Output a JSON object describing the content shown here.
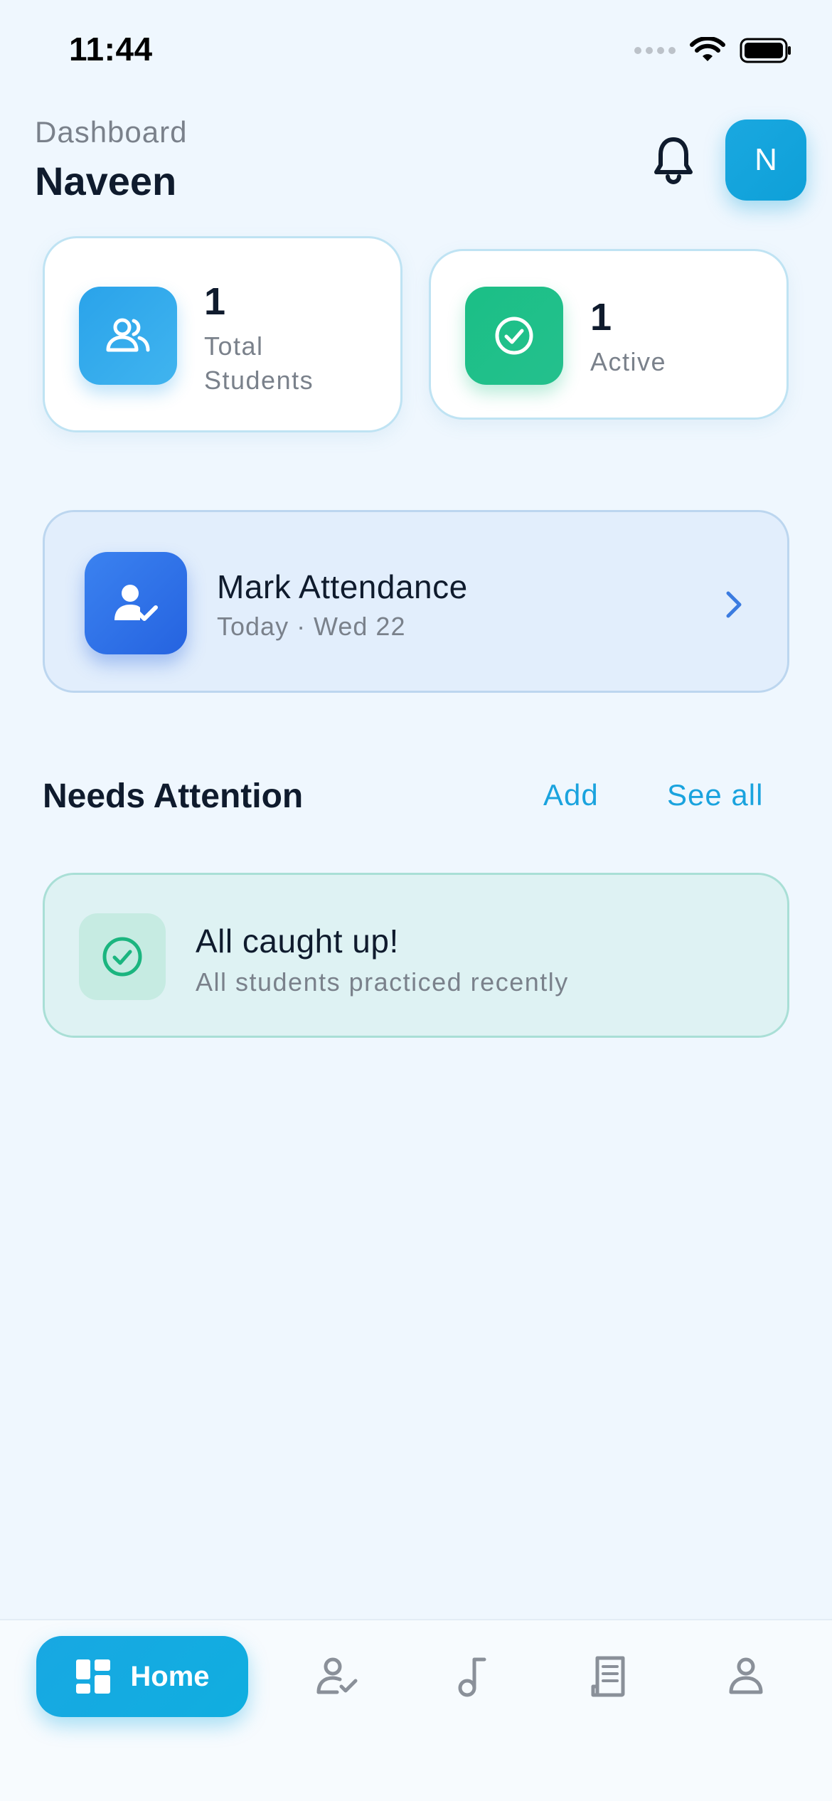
{
  "status_bar": {
    "time": "11:44"
  },
  "header": {
    "label": "Dashboard",
    "name": "Naveen",
    "avatar_initial": "N"
  },
  "stats": [
    {
      "value": "1",
      "label": "Total Students",
      "icon": "users-icon"
    },
    {
      "value": "1",
      "label": "Active",
      "icon": "check-circle-icon"
    }
  ],
  "attendance": {
    "title": "Mark Attendance",
    "subtitle": "Today · Wed 22"
  },
  "needs_attention": {
    "title": "Needs Attention",
    "add_label": "Add",
    "see_all_label": "See all"
  },
  "caught_up": {
    "title": "All caught up!",
    "subtitle": "All students practiced recently"
  },
  "bottom_nav": {
    "items": [
      {
        "label": "Home",
        "icon": "grid-icon",
        "active": true
      },
      {
        "label": "",
        "icon": "user-check-icon",
        "active": false
      },
      {
        "label": "",
        "icon": "music-note-icon",
        "active": false
      },
      {
        "label": "",
        "icon": "receipt-icon",
        "active": false
      },
      {
        "label": "",
        "icon": "profile-icon",
        "active": false
      }
    ]
  },
  "colors": {
    "background": "#eff7fe",
    "accent": "#1aa3de",
    "blue": "#2563e0",
    "green": "#1bbf86"
  }
}
